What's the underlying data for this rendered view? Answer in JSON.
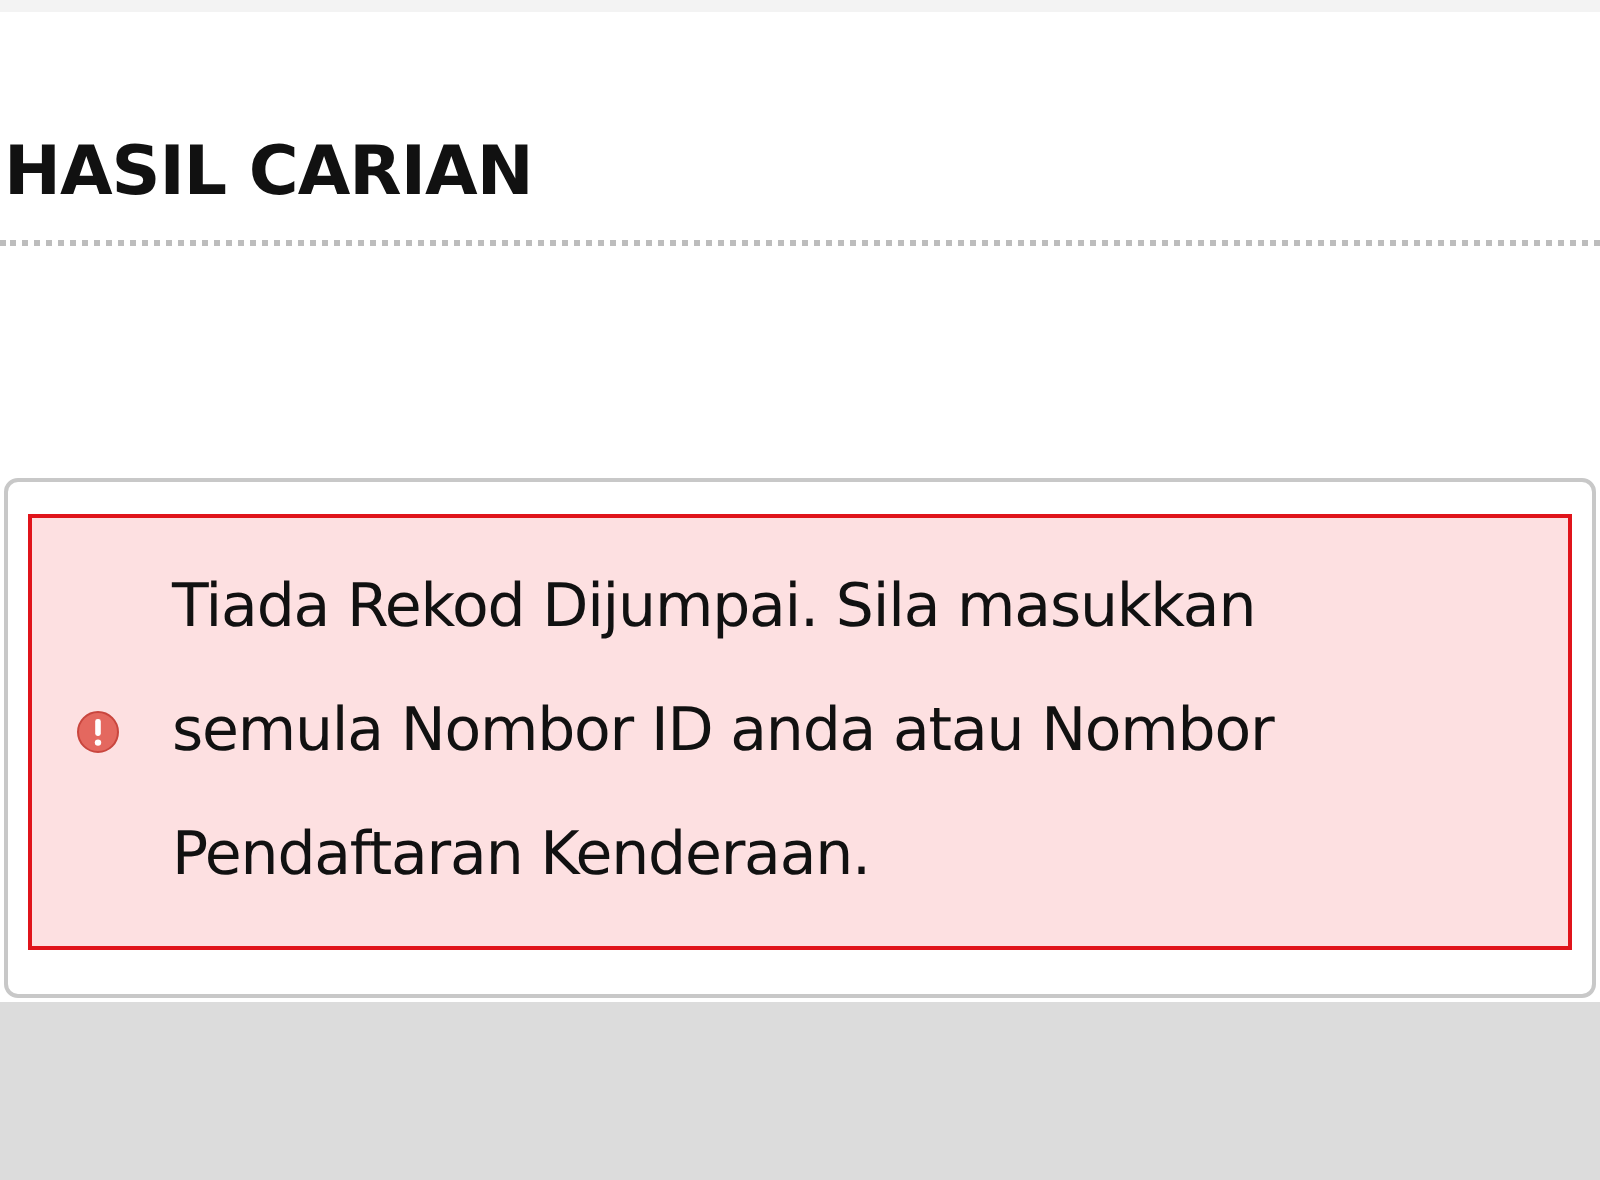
{
  "heading": "HASIL CARIAN",
  "alert": {
    "kind": "error",
    "message": "Tiada Rekod Dijumpai. Sila masukkan semula Nombor ID anda atau Nombor Pendaftaran Kenderaan."
  }
}
